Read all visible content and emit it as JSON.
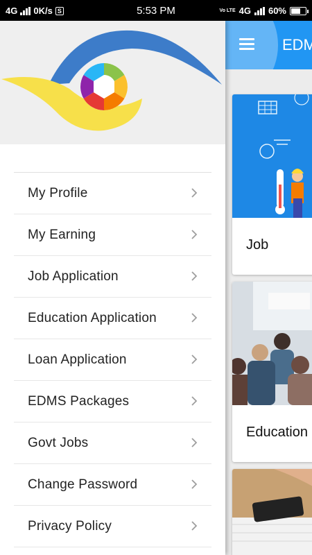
{
  "status_bar": {
    "network": "4G",
    "speed": "0K/s",
    "s_badge": "S",
    "time": "5:53 PM",
    "volte": "Vo LTE",
    "network_right": "4G",
    "battery_percent": "60%",
    "battery_level": 0.6
  },
  "toolbar": {
    "title": "EDMS",
    "menu_icon": "hamburger-icon"
  },
  "cards": [
    {
      "label": "Job"
    },
    {
      "label": "Education"
    },
    {
      "label": ""
    }
  ],
  "drawer": {
    "logo_icon": "edms-eye-logo",
    "items": [
      {
        "label": "My Profile",
        "icon": "chevron-right-icon"
      },
      {
        "label": "My Earning",
        "icon": "chevron-right-icon"
      },
      {
        "label": "Job Application",
        "icon": "chevron-right-icon"
      },
      {
        "label": "Education Application",
        "icon": "chevron-right-icon"
      },
      {
        "label": "Loan Application",
        "icon": "chevron-right-icon"
      },
      {
        "label": "EDMS Packages",
        "icon": "chevron-right-icon"
      },
      {
        "label": "Govt Jobs",
        "icon": "chevron-right-icon"
      },
      {
        "label": "Change Password",
        "icon": "chevron-right-icon"
      },
      {
        "label": "Privacy Policy",
        "icon": "chevron-right-icon"
      }
    ]
  },
  "colors": {
    "primary": "#2196f3",
    "primary_light": "#64b5f6",
    "logo_blue": "#3d7cc9",
    "logo_yellow": "#f7e04a"
  }
}
